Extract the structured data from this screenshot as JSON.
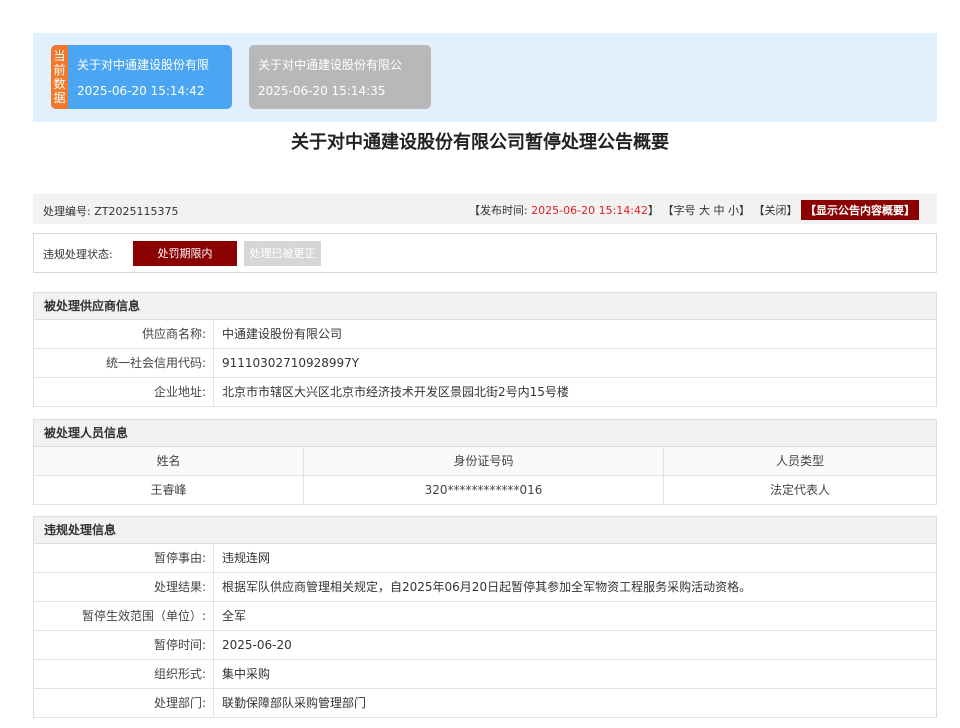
{
  "tabs": [
    {
      "badge": "当前数据",
      "title": "关于对中通建设股份有限",
      "time": "2025-06-20 15:14:42"
    },
    {
      "title": "关于对中通建设股份有限公",
      "time": "2025-06-20 15:14:35"
    }
  ],
  "page_title": "关于对中通建设股份有限公司暂停处理公告概要",
  "info": {
    "code_label": "处理编号: ",
    "code_value": "ZT2025115375",
    "publish_open": "【发布时间: ",
    "publish_time": "2025-06-20 15:14:42",
    "publish_close": "】",
    "font_open": "【字号 ",
    "font_large": "大",
    "font_medium": "中",
    "font_small": "小",
    "font_close": "】",
    "close_link": "【关闭】",
    "summary_button": "【显示公告内容概要】"
  },
  "status": {
    "label": "违规处理状态:",
    "active": "处罚期限内",
    "inactive": "处理已被更正"
  },
  "supplier": {
    "title": "被处理供应商信息",
    "rows": [
      {
        "label": "供应商名称:",
        "value": "中通建设股份有限公司"
      },
      {
        "label": "统一社会信用代码:",
        "value": "91110302710928997Y"
      },
      {
        "label": "企业地址:",
        "value": "北京市市辖区大兴区北京市经济技术开发区景园北街2号内15号楼"
      }
    ]
  },
  "personnel": {
    "title": "被处理人员信息",
    "headers": [
      "姓名",
      "身份证号码",
      "人员类型"
    ],
    "rows": [
      [
        "王睿峰",
        "320************016",
        "法定代表人"
      ]
    ]
  },
  "violation": {
    "title": "违规处理信息",
    "rows": [
      {
        "label": "暂停事由:",
        "value": "违规连网"
      },
      {
        "label": "处理结果:",
        "value": "根据军队供应商管理相关规定，自2025年06月20日起暂停其参加全军物资工程服务采购活动资格。"
      },
      {
        "label": "暂停生效范围（单位）:",
        "value": "全军"
      },
      {
        "label": "暂停时间:",
        "value": "2025-06-20"
      },
      {
        "label": "组织形式:",
        "value": "集中采购"
      },
      {
        "label": "处理部门:",
        "value": "联勤保障部队采购管理部门"
      }
    ]
  },
  "colors": {
    "current_tab": "#4aa6f2",
    "badge": "#f07a2b",
    "other_tab": "#b8b8b8",
    "accent_dark_red": "#8b0000",
    "publish_time_red": "#e02020"
  }
}
